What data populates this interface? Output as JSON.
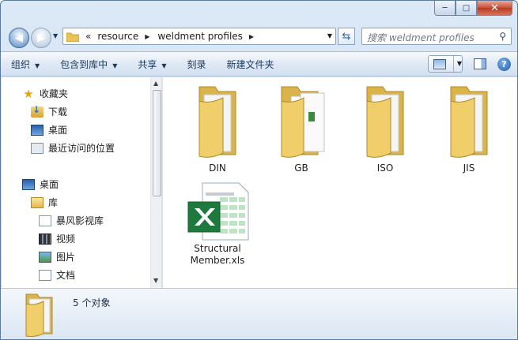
{
  "window": {
    "buttons": {
      "minimize": "─",
      "maximize": "□",
      "close": "✕"
    }
  },
  "address": {
    "overflow": "«",
    "breadcrumbs": [
      "resource",
      "weldment profiles"
    ]
  },
  "search": {
    "placeholder": "搜索 weldment profiles"
  },
  "toolbar": {
    "items": [
      {
        "label": "组织",
        "dropdown": true
      },
      {
        "label": "包含到库中",
        "dropdown": true
      },
      {
        "label": "共享",
        "dropdown": true
      },
      {
        "label": "刻录",
        "dropdown": false
      },
      {
        "label": "新建文件夹",
        "dropdown": false
      }
    ],
    "help": "?"
  },
  "nav_pane": {
    "items": [
      {
        "label": "收藏夹",
        "icon": "star-icon"
      },
      {
        "label": "下载",
        "icon": "download-folder-icon"
      },
      {
        "label": "桌面",
        "icon": "desktop-icon"
      },
      {
        "label": "最近访问的位置",
        "icon": "recent-places-icon"
      },
      {
        "label": "桌面",
        "icon": "desktop-icon"
      },
      {
        "label": "库",
        "icon": "library-icon"
      },
      {
        "label": "暴风影视库",
        "icon": "media-library-icon"
      },
      {
        "label": "视频",
        "icon": "video-icon"
      },
      {
        "label": "图片",
        "icon": "pictures-icon"
      },
      {
        "label": "文档",
        "icon": "documents-icon"
      }
    ]
  },
  "files": [
    {
      "name": "DIN",
      "type": "folder"
    },
    {
      "name": "GB",
      "type": "folder-with-content"
    },
    {
      "name": "ISO",
      "type": "folder"
    },
    {
      "name": "JIS",
      "type": "folder"
    },
    {
      "name": "Structural",
      "name2": "Member.xls",
      "type": "excel"
    }
  ],
  "details": {
    "count": "5 个对象"
  },
  "colors": {
    "accent": "#2f6bb3",
    "folder": "#e8c35a",
    "excel": "#1e7a3c"
  }
}
